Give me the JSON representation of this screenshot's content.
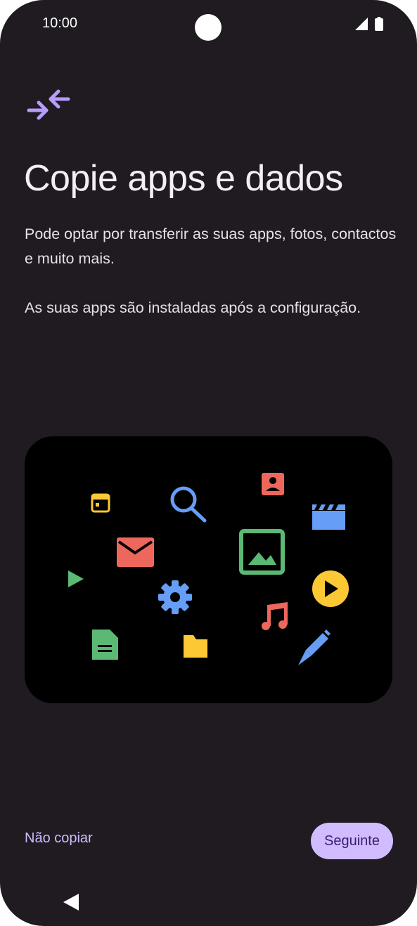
{
  "status_bar": {
    "time": "10:00",
    "icons": [
      "signal-icon",
      "battery-icon"
    ]
  },
  "header": {
    "icon": "transfer-arrows-icon",
    "title": "Copie apps e dados"
  },
  "body": {
    "description": "Pode optar por transferir as suas apps, fotos, contactos e muito mais.",
    "note": "As suas apps são instaladas após a configuração."
  },
  "illustration": {
    "icons": [
      "calendar-icon",
      "search-icon",
      "contact-icon",
      "movie-icon",
      "mail-icon",
      "image-icon",
      "play-store-icon",
      "settings-icon",
      "play-circle-icon",
      "music-icon",
      "document-icon",
      "folder-icon",
      "pencil-icon"
    ]
  },
  "actions": {
    "skip_label": "Não copiar",
    "next_label": "Seguinte"
  },
  "navigation": {
    "back_icon": "back-triangle-icon"
  },
  "colors": {
    "background": "#1f1b21",
    "accent": "#d0bcff",
    "on_accent": "#381e72",
    "icon_yellow": "#fcc934",
    "icon_blue": "#669df6",
    "icon_red": "#ee675c",
    "icon_green": "#5bb974"
  }
}
